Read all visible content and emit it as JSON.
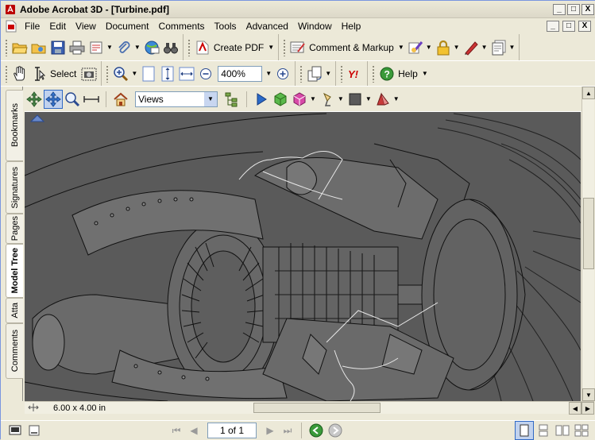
{
  "window": {
    "title": "Adobe Acrobat 3D - [Turbine.pdf]",
    "min_label": "_",
    "max_label": "□",
    "close_label": "X"
  },
  "menu": {
    "items": [
      "File",
      "Edit",
      "View",
      "Document",
      "Comments",
      "Tools",
      "Advanced",
      "Window",
      "Help"
    ],
    "doc_controls": [
      "_",
      "□",
      "X"
    ]
  },
  "toolbar1": {
    "create_pdf": "Create PDF",
    "comment_markup": "Comment & Markup"
  },
  "toolbar2": {
    "select_label": "Select",
    "zoom_value": "400%",
    "help_label": "Help"
  },
  "sidebar": {
    "tabs": [
      "Bookmarks",
      "Signatures",
      "Pages",
      "Model Tree",
      "Atta",
      "Comments"
    ],
    "active_tab": "Model Tree"
  },
  "toolbar3": {
    "views_value": "Views"
  },
  "hbar": {
    "page_size": "6.00 x 4.00 in"
  },
  "status": {
    "page_indicator": "1 of 1"
  },
  "colors": {
    "canvas_bg": "#5a5a5a",
    "chrome": "#ece9d8"
  }
}
